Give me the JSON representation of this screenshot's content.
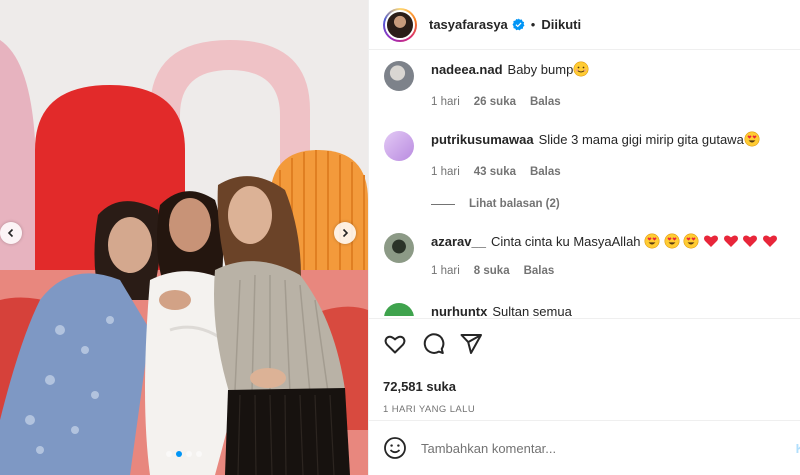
{
  "post": {
    "username": "tasyafarasya",
    "follow_state": "Diikuti",
    "separator": "•",
    "verified": true,
    "likes": "72,581 suka",
    "posted_time": "1 HARI YANG LALU",
    "carousel_count": 4,
    "carousel_active_index": 1
  },
  "comments": [
    {
      "username": "nadeea.nad",
      "text": "Baby bump",
      "emojis": [
        "smiling-face"
      ],
      "time": "1 hari",
      "likes": "26 suka",
      "reply": "Balas",
      "avatar_color": "#8a8f96"
    },
    {
      "username": "putrikusumawaa",
      "text": "Slide 3 mama gigi mirip gita gutawa",
      "emojis": [
        "heart-eyes"
      ],
      "time": "1 hari",
      "likes": "43 suka",
      "reply": "Balas",
      "avatar_color": "#c9a3e6"
    },
    {
      "username": "azarav__",
      "text": "Cinta cinta ku MasyaAllah",
      "emojis": [
        "heart-eyes",
        "heart-eyes",
        "heart-eyes",
        "red-heart",
        "red-heart",
        "red-heart",
        "red-heart"
      ],
      "time": "1 hari",
      "likes": "8 suka",
      "reply": "Balas",
      "avatar_color": "#4b5b46"
    },
    {
      "username": "nurhuntx",
      "text": "Sultan semua",
      "avatar_color": "#3fa34d"
    }
  ],
  "view_replies": "Lihat balasan (2)",
  "add_comment": {
    "placeholder": "Tambahkan komentar...",
    "post_label": "K"
  },
  "icons": [
    "heart-icon",
    "comment-icon",
    "share-icon",
    "emoji-icon",
    "chevron-left-icon",
    "chevron-right-icon",
    "verified-badge-icon"
  ],
  "colors": {
    "accent": "#0095f6",
    "text": "#262626",
    "secondary": "#737373",
    "border": "#efefef"
  }
}
